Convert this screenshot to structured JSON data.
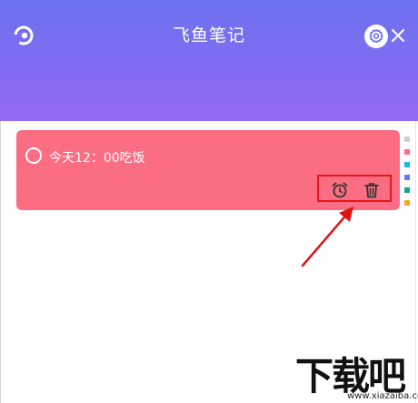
{
  "app": {
    "title": "飞鱼笔记"
  },
  "note": {
    "text": "今天12：00吃饭"
  },
  "palette": [
    "#cfcfcf",
    "#fb6d82",
    "#1fb6ee",
    "#6b72ee",
    "#1aa589",
    "#f5a623"
  ],
  "watermark": {
    "logo": "下载吧",
    "url": "www.xiazaiba.com"
  }
}
